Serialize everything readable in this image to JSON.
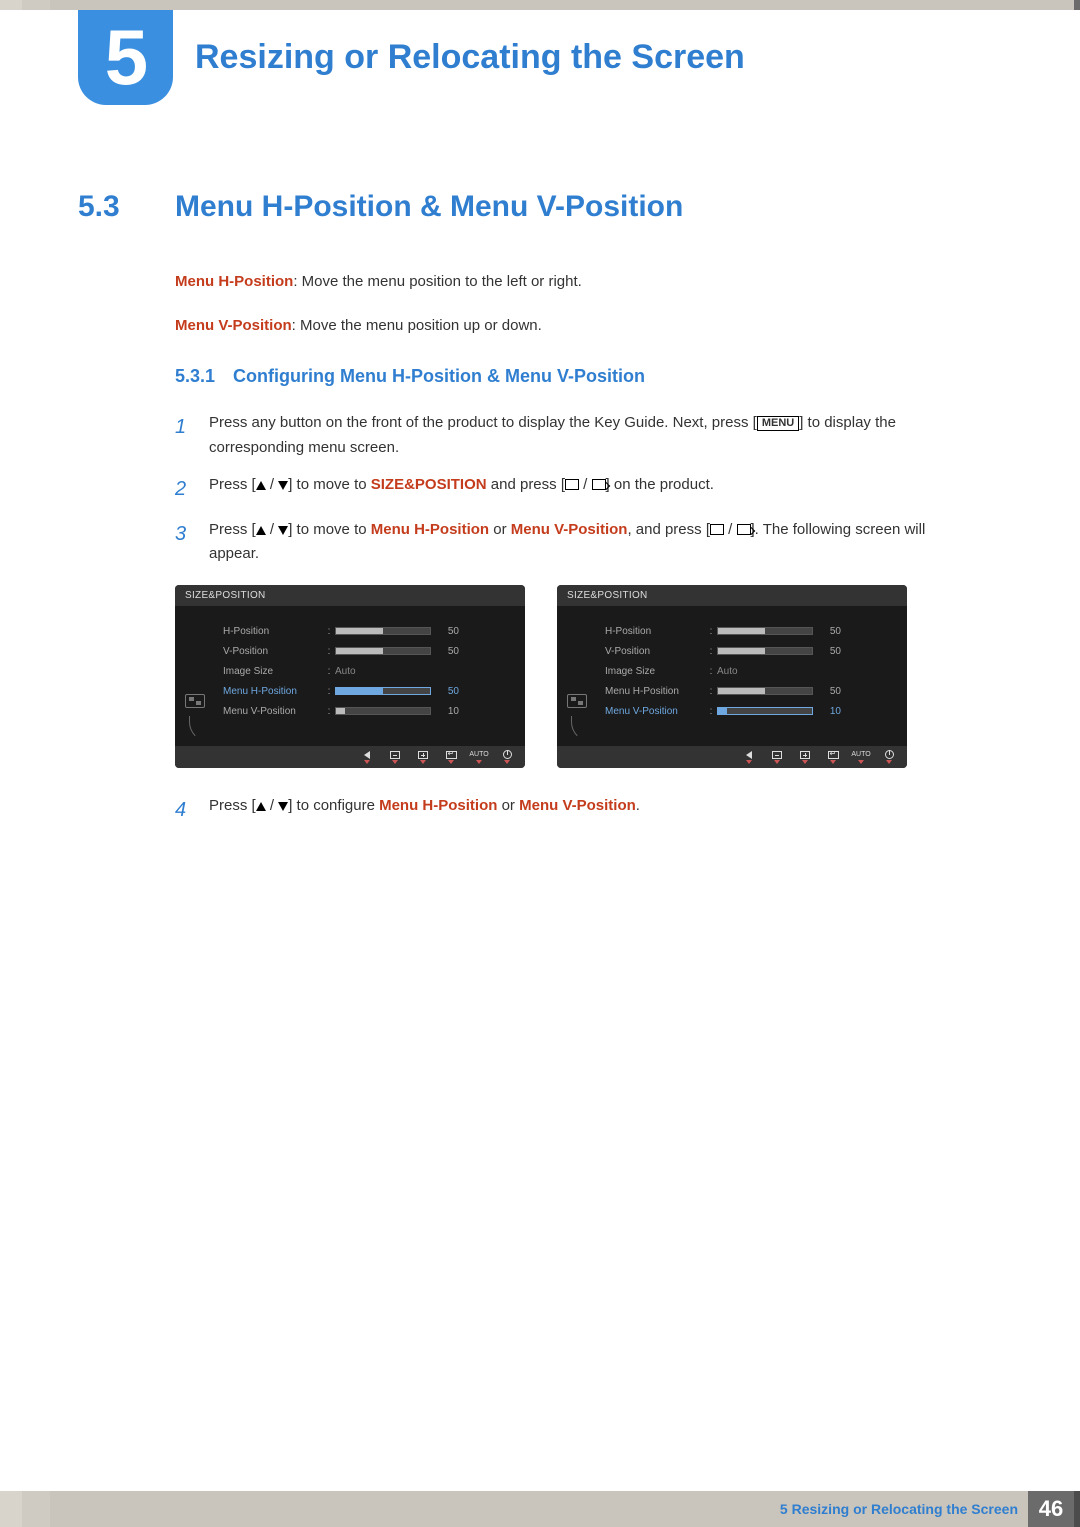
{
  "chapter": {
    "number": "5",
    "title": "Resizing or Relocating the Screen"
  },
  "section": {
    "number": "5.3",
    "title": "Menu H-Position & Menu V-Position"
  },
  "intro": {
    "h_label": "Menu H-Position",
    "h_text": ": Move the menu position to the left or right.",
    "v_label": "Menu V-Position",
    "v_text": ": Move the menu position up or down."
  },
  "subsection": {
    "number": "5.3.1",
    "title": "Configuring Menu H-Position & Menu V-Position"
  },
  "steps": {
    "s1a": "Press any button on the front of the product to display the Key Guide. Next, press [",
    "s1_menu": "MENU",
    "s1b": "] to display the corresponding menu screen.",
    "s2a": "Press [",
    "s2b": "] to move to ",
    "s2_kw": "SIZE&POSITION",
    "s2c": " and press [",
    "s2d": "] on the product.",
    "s3a": "Press [",
    "s3b": "] to move to ",
    "s3_kw1": "Menu H-Position",
    "s3_or": " or ",
    "s3_kw2": "Menu V-Position",
    "s3c": ", and press [",
    "s3d": "]. The following screen will appear.",
    "s4a": "Press [",
    "s4b": "] to configure ",
    "s4_kw1": "Menu H-Position",
    "s4_or": " or ",
    "s4_kw2": "Menu V-Position",
    "s4c": "."
  },
  "osd": {
    "header": "SIZE&POSITION",
    "rows": {
      "hpos": "H-Position",
      "vpos": "V-Position",
      "imgsize": "Image Size",
      "imgsize_val": "Auto",
      "mhpos": "Menu H-Position",
      "mvpos": "Menu V-Position"
    },
    "vals": {
      "v50": "50",
      "v10": "10"
    },
    "footer_auto": "AUTO"
  },
  "footer": {
    "prefix": "5",
    "text": "Resizing or Relocating the Screen",
    "page": "46"
  }
}
